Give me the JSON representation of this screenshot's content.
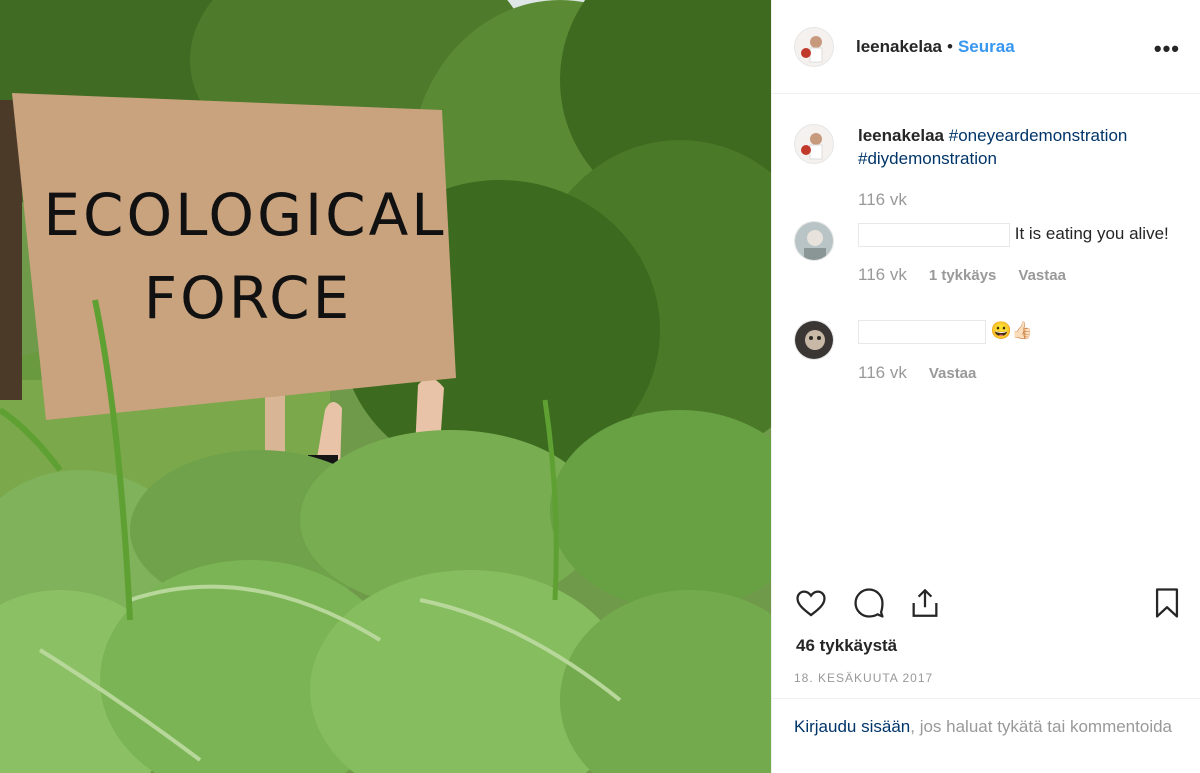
{
  "post": {
    "username": "leenakelaa",
    "separator": "•",
    "follow_label": "Seuraa",
    "more_label": "•••",
    "sign_line1": "ECOLOGICAL",
    "sign_line2": "FORCE"
  },
  "caption": {
    "username": "leenakelaa",
    "hashtag1": "#oneyeardemonstration",
    "hashtag2": "#diydemonstration",
    "time": "116 vk"
  },
  "comments": [
    {
      "text": "It is eating you alive!",
      "time": "116 vk",
      "likes": "1 tykkäys",
      "reply": "Vastaa"
    },
    {
      "text": "😀👍🏻",
      "time": "116 vk",
      "reply": "Vastaa"
    }
  ],
  "likes_count": "46 tykkäystä",
  "date": "18. KESÄKUUTA 2017",
  "footer": {
    "login_link": "Kirjaudu sisään",
    "rest": ", jos haluat tykätä tai kommentoida"
  },
  "colors": {
    "follow": "#3897f0",
    "hashtag": "#003569",
    "muted": "#999999",
    "sign": "#c9a27e"
  },
  "icons": [
    "heart-icon",
    "comment-icon",
    "share-icon",
    "bookmark-icon",
    "more-icon"
  ]
}
